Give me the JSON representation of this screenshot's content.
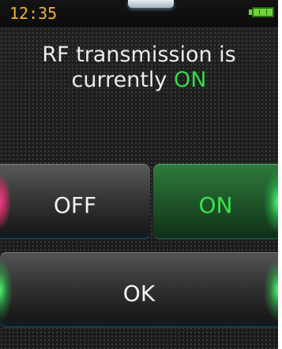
{
  "status": {
    "time": "12:35",
    "battery_icon": "battery-full-icon"
  },
  "message": {
    "text_prefix": "RF transmission is",
    "text_line2": "currently",
    "state": "ON"
  },
  "buttons": {
    "off_label": "OFF",
    "on_label": "ON",
    "ok_label": "OK"
  },
  "colors": {
    "clock": "#f0b23a",
    "state_on": "#39d94a",
    "battery": "#6ed43a"
  }
}
